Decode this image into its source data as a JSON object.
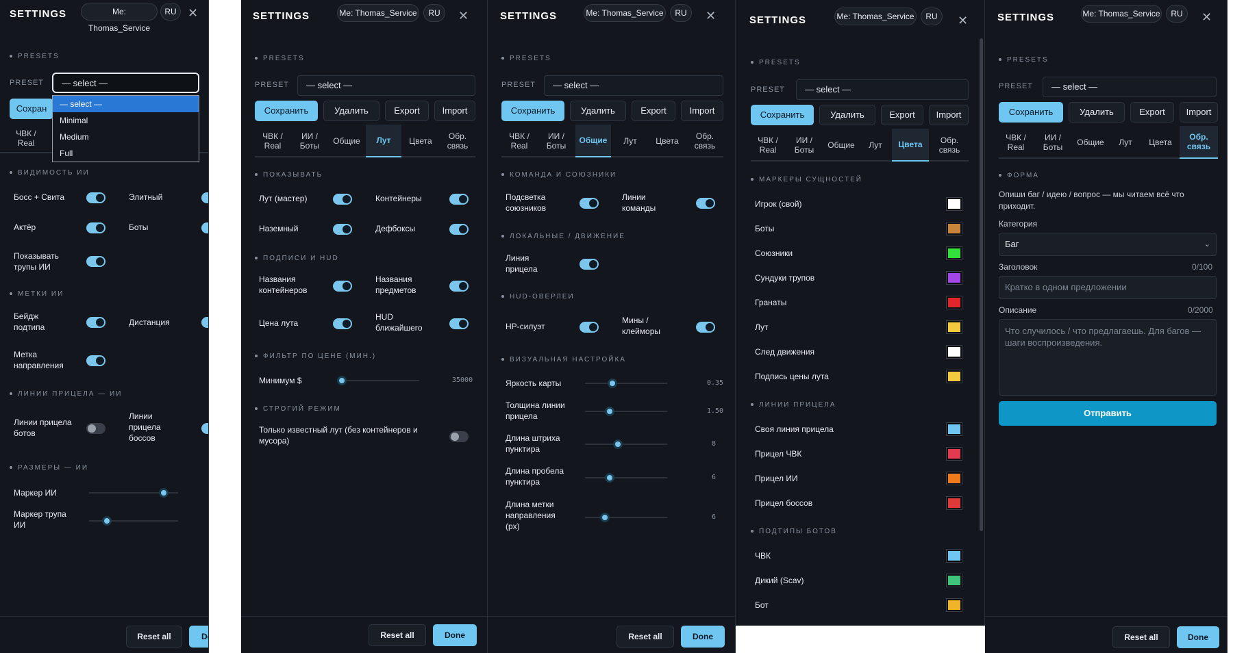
{
  "common": {
    "title": "SETTINGS",
    "user_pill": "Me: Thomas_Service",
    "lang_pill": "RU",
    "close": "✕",
    "presets_section": "PRESETS",
    "preset_label": "PRESET",
    "select_value": "— select —",
    "save": "Сохранить",
    "delete": "Удалить",
    "export": "Export",
    "import": "Import",
    "reset_all": "Reset all",
    "done": "Done",
    "save_partial": "Сохран"
  },
  "tabs": {
    "pmc": "ЧВК / Real",
    "ai": "ИИ / Боты",
    "general": "Общие",
    "loot": "Лут",
    "colors": "Цвета",
    "feedback": "Обр. связь",
    "pmc_partial": "ЧВК / Real"
  },
  "p1": {
    "dropdown_options": [
      "— select —",
      "Minimal",
      "Medium",
      "Full"
    ],
    "sec_visibility": "ВИДИМОСТЬ ИИ",
    "boss_suite": "Босс + Свита",
    "elite": "Элитный",
    "actor": "Актёр",
    "bots": "Боты",
    "show_corpses": "Показывать трупы ИИ",
    "sec_marks": "МЕТКИ ИИ",
    "sub_badge": "Бейдж подтипа",
    "distance": "Дистанция",
    "direction_mark": "Метка направления",
    "sec_aim": "ЛИНИИ ПРИЦЕЛА — ИИ",
    "bot_aim": "Линии прицела ботов",
    "boss_aim": "Линии прицела боссов",
    "sec_sizes": "РАЗМЕРЫ — ИИ",
    "ai_marker": "Маркер ИИ",
    "ai_marker_val": "14",
    "corpse_marker": "Маркер трупа ИИ",
    "corpse_marker_val": "5"
  },
  "p2": {
    "sec_show": "ПОКАЗЫВАТЬ",
    "loot_master": "Лут (мастер)",
    "containers": "Контейнеры",
    "ground": "Наземный",
    "deadboxes": "Дефбоксы",
    "sec_captions": "ПОДПИСИ И HUD",
    "container_names": "Названия контейнеров",
    "item_names": "Названия предметов",
    "loot_price": "Цена лута",
    "hud_nearest": "HUD ближайшего",
    "sec_price": "ФИЛЬТР ПО ЦЕНЕ (МИН.)",
    "min_price": "Минимум $",
    "min_price_val": "35000",
    "sec_strict": "СТРОГИЙ РЕЖИМ",
    "strict_known": "Только известный лут (без контейнеров и мусора)"
  },
  "p3": {
    "sec_team": "КОМАНДА И СОЮЗНИКИ",
    "ally_highlight": "Подсветка союзников",
    "team_lines": "Линии команды",
    "sec_local": "ЛОКАЛЬНЫЕ / ДВИЖЕНИЕ",
    "aim_line": "Линия прицела",
    "sec_hud": "HUD-ОВЕРЛЕИ",
    "hp_silhouette": "HP-силуэт",
    "mines": "Мины / клейморы",
    "sec_visual": "ВИЗУАЛЬНАЯ НАСТРОЙКА",
    "map_brightness": "Яркость карты",
    "map_brightness_val": "0.35",
    "aim_thickness": "Толщина линии прицела",
    "aim_thickness_val": "1.50",
    "dash_length": "Длина штриха пунктира",
    "dash_length_val": "8",
    "gap_length": "Длина пробела пунктира",
    "gap_length_val": "6",
    "dir_length": "Длина метки направления (px)",
    "dir_length_val": "6"
  },
  "p4": {
    "sec_markers": "МАРКЕРЫ СУЩНОСТЕЙ",
    "player_own": "Игрок (свой)",
    "bots": "Боты",
    "allies": "Союзники",
    "corpse_chests": "Сундуки трупов",
    "grenades": "Гранаты",
    "loot": "Лут",
    "trail": "След движения",
    "loot_price_caption": "Подпись цены лута",
    "sec_aim": "ЛИНИИ ПРИЦЕЛА",
    "own_aim": "Своя линия прицела",
    "pmc_aim": "Прицел ЧВК",
    "ai_aim": "Прицел ИИ",
    "boss_aim": "Прицел боссов",
    "sec_bot_types": "ПОДТИПЫ БОТОВ",
    "pmc": "ЧВК",
    "scav": "Дикий (Scav)",
    "bot": "Бот",
    "colors": {
      "player_own": "#ffffff",
      "bots": "#c8843a",
      "allies": "#34e03c",
      "corpse_chests": "#a246e6",
      "grenades": "#e0262a",
      "loot": "#f3c93d",
      "trail": "#ffffff",
      "loot_price_caption": "#f3c93d",
      "own_aim": "#6ec6f1",
      "pmc_aim": "#e23a4e",
      "ai_aim": "#ee7a1c",
      "boss_aim": "#df3a3a",
      "pmc": "#6ec6f1",
      "scav": "#3cc47a",
      "bot": "#f0b429"
    }
  },
  "p5": {
    "sec_form": "ФОРМА",
    "intro": "Опиши баг / идею / вопрос — мы читаем всё что приходит.",
    "category_label": "Категория",
    "category_value": "Баг",
    "title_label": "Заголовок",
    "title_counter": "0/100",
    "title_placeholder": "Кратко в одном предложении",
    "desc_label": "Описание",
    "desc_counter": "0/2000",
    "desc_placeholder": "Что случилось / что предлагаешь. Для багов — шаги воспроизведения.",
    "submit": "Отправить"
  }
}
